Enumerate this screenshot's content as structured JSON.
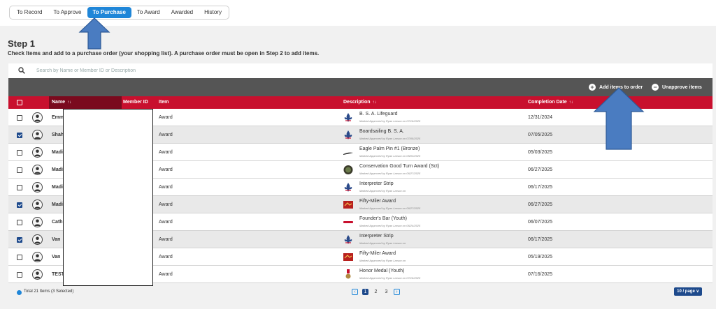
{
  "tabs": [
    {
      "label": "To Record"
    },
    {
      "label": "To Approve"
    },
    {
      "label": "To Purchase"
    },
    {
      "label": "To Award"
    },
    {
      "label": "Awarded"
    },
    {
      "label": "History"
    }
  ],
  "active_tab": "To Purchase",
  "step": {
    "title": "Step 1",
    "subtitle": "Check Items and add to a purchase order (your shopping list). A purchase order must be open in Step 2 to add items."
  },
  "search": {
    "placeholder": "Search by Name or Member ID or Description",
    "value": ""
  },
  "actions": {
    "add_label": "Add items to order",
    "unapprove_label": "Unapprove items"
  },
  "columns": {
    "name": "Name",
    "member_id": "Member ID",
    "item": "Item",
    "description": "Description",
    "completion_date": "Completion Date",
    "sort_glyph": "↑↓"
  },
  "rows": [
    {
      "name": "Emm",
      "item": "Award",
      "desc": "B. S. A. Lifeguard",
      "sub": "Marked Approved by Ryan Larson on 07/16/2025",
      "date": "12/31/2024",
      "checked": false,
      "icon": "fleur-de-lis-icon"
    },
    {
      "name": "Shah",
      "item": "Award",
      "desc": "Boardsailing B. S. A.",
      "sub": "Marked Approved by Ryan Larson on 07/05/2025",
      "date": "07/05/2025",
      "checked": true,
      "icon": "fleur-de-lis-icon"
    },
    {
      "name": "Madi",
      "item": "Award",
      "desc": "Eagle Palm Pin #1 (Bronze)",
      "sub": "Marked Approved by Ryan Larson on 05/03/2025",
      "date": "05/03/2025",
      "checked": false,
      "icon": "palm-pin-icon"
    },
    {
      "name": "Madi",
      "item": "Award",
      "desc": "Conservation Good Turn Award (Sct)",
      "sub": "Marked Approved by Ryan Larson on 06/27/2025",
      "date": "06/27/2025",
      "checked": false,
      "icon": "round-patch-icon"
    },
    {
      "name": "Madi",
      "item": "Award",
      "desc": "Interpreter Strip",
      "sub": "Marked Approved by Ryan Larson on",
      "date": "06/17/2025",
      "checked": false,
      "icon": "fleur-de-lis-icon"
    },
    {
      "name": "Madi",
      "item": "Award",
      "desc": "Fifty-Miler Award",
      "sub": "Marked Approved by Ryan Larson on 06/27/2025",
      "date": "06/27/2025",
      "checked": true,
      "icon": "red-patch-icon"
    },
    {
      "name": "Cath",
      "item": "Award",
      "desc": "Founder's Bar (Youth)",
      "sub": "Marked Approved by Ryan Larson on 06/24/2025",
      "date": "06/07/2025",
      "checked": false,
      "icon": "bar-pin-icon"
    },
    {
      "name": "Van",
      "item": "Award",
      "desc": "Interpreter Strip",
      "sub": "Marked Approved by Ryan Larson on",
      "date": "06/17/2025",
      "checked": true,
      "icon": "fleur-de-lis-icon"
    },
    {
      "name": "Van",
      "item": "Award",
      "desc": "Fifty-Miler Award",
      "sub": "Marked Approved by Ryan Larson on",
      "date": "05/19/2025",
      "checked": false,
      "icon": "red-patch-icon"
    },
    {
      "name": "TEST",
      "item": "Award",
      "desc": "Honor Medal (Youth)",
      "sub": "Marked Approved by Ryan Larson on 07/16/2025",
      "date": "07/16/2025",
      "checked": false,
      "icon": "medal-icon"
    }
  ],
  "footer": {
    "total": "Total 21 Items (3 Selected)",
    "pages": [
      "1",
      "2",
      "3"
    ],
    "current_page": "1",
    "prev_glyph": "‹",
    "next_glyph": "›",
    "per_page": "10 / page ∨"
  },
  "colors": {
    "accent": "#1f86d8",
    "header_red": "#c8102e",
    "action_bar": "#555555",
    "selected_row": "#e9e9e9",
    "annotation_arrow": "#4a7cc1"
  }
}
